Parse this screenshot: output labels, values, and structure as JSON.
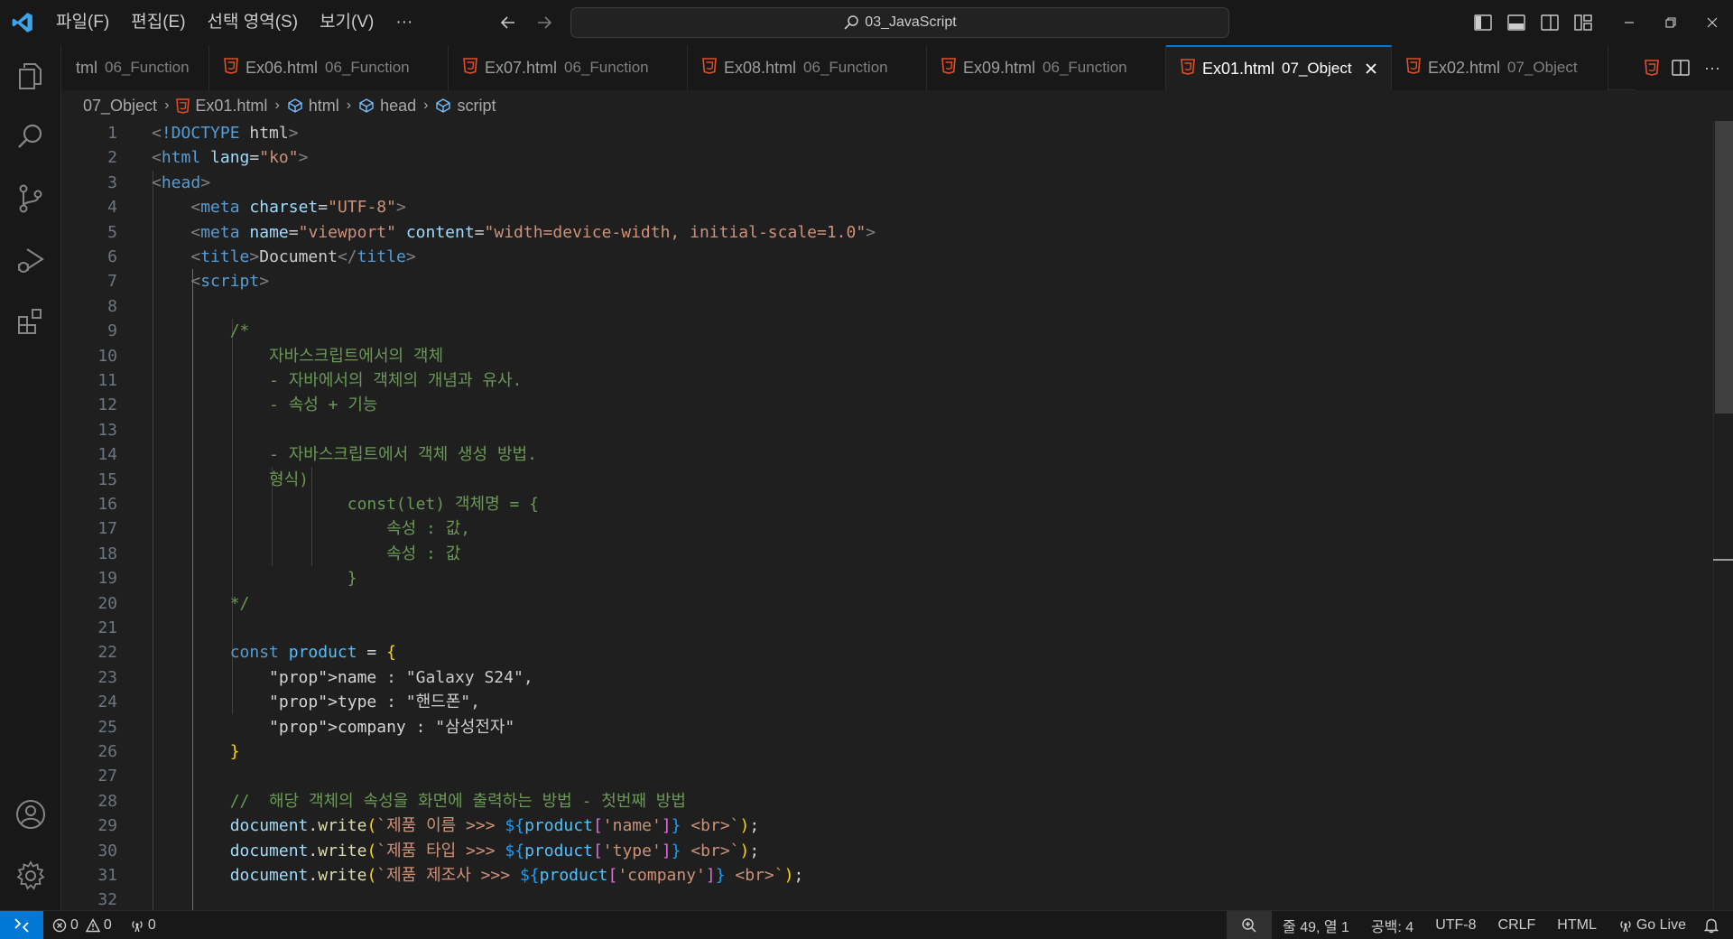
{
  "menu": [
    "파일(F)",
    "편집(E)",
    "선택 영역(S)",
    "보기(V)",
    "···"
  ],
  "search": {
    "text": "03_JavaScript"
  },
  "tabs": [
    {
      "name": "tml",
      "desc": "06_Function",
      "icon": false
    },
    {
      "name": "Ex06.html",
      "desc": "06_Function",
      "icon": true
    },
    {
      "name": "Ex07.html",
      "desc": "06_Function",
      "icon": true
    },
    {
      "name": "Ex08.html",
      "desc": "06_Function",
      "icon": true
    },
    {
      "name": "Ex09.html",
      "desc": "06_Function",
      "icon": true
    },
    {
      "name": "Ex01.html",
      "desc": "07_Object",
      "icon": true,
      "active": true
    },
    {
      "name": "Ex02.html",
      "desc": "07_Object",
      "icon": true
    }
  ],
  "breadcrumb": {
    "folder": "07_Object",
    "file": "Ex01.html",
    "nodes": [
      "html",
      "head",
      "script"
    ]
  },
  "code_lines": [
    "<!DOCTYPE html>",
    "<html lang=\"ko\">",
    "<head>",
    "    <meta charset=\"UTF-8\">",
    "    <meta name=\"viewport\" content=\"width=device-width, initial-scale=1.0\">",
    "    <title>Document</title>",
    "    <script>",
    "",
    "        /*",
    "            자바스크립트에서의 객체",
    "            - 자바에서의 객체의 개념과 유사.",
    "            - 속성 + 기능",
    "",
    "            - 자바스크립트에서 객체 생성 방법.",
    "            형식)",
    "                    const(let) 객체명 = {",
    "                        속성 : 값,",
    "                        속성 : 값",
    "                    }",
    "        */",
    "",
    "        const product = {",
    "            name : \"Galaxy S24\",",
    "            type : \"핸드폰\",",
    "            company : \"삼성전자\"",
    "        }",
    "",
    "        //  해당 객체의 속성을 화면에 출력하는 방법 - 첫번째 방법",
    "        document.write(`제품 이름 >>> ${product['name']} <br>`);",
    "        document.write(`제품 타입 >>> ${product['type']} <br>`);",
    "        document.write(`제품 제조사 >>> ${product['company']} <br>`);",
    ""
  ],
  "status": {
    "errors": "0",
    "warnings": "0",
    "ports": "0",
    "position": "줄 49, 열 1",
    "spaces": "공백: 4",
    "encoding": "UTF-8",
    "eol": "CRLF",
    "language": "HTML",
    "golive": "Go Live"
  },
  "colors": {
    "accent": "#0078d4",
    "html_icon": "#e44d26"
  }
}
